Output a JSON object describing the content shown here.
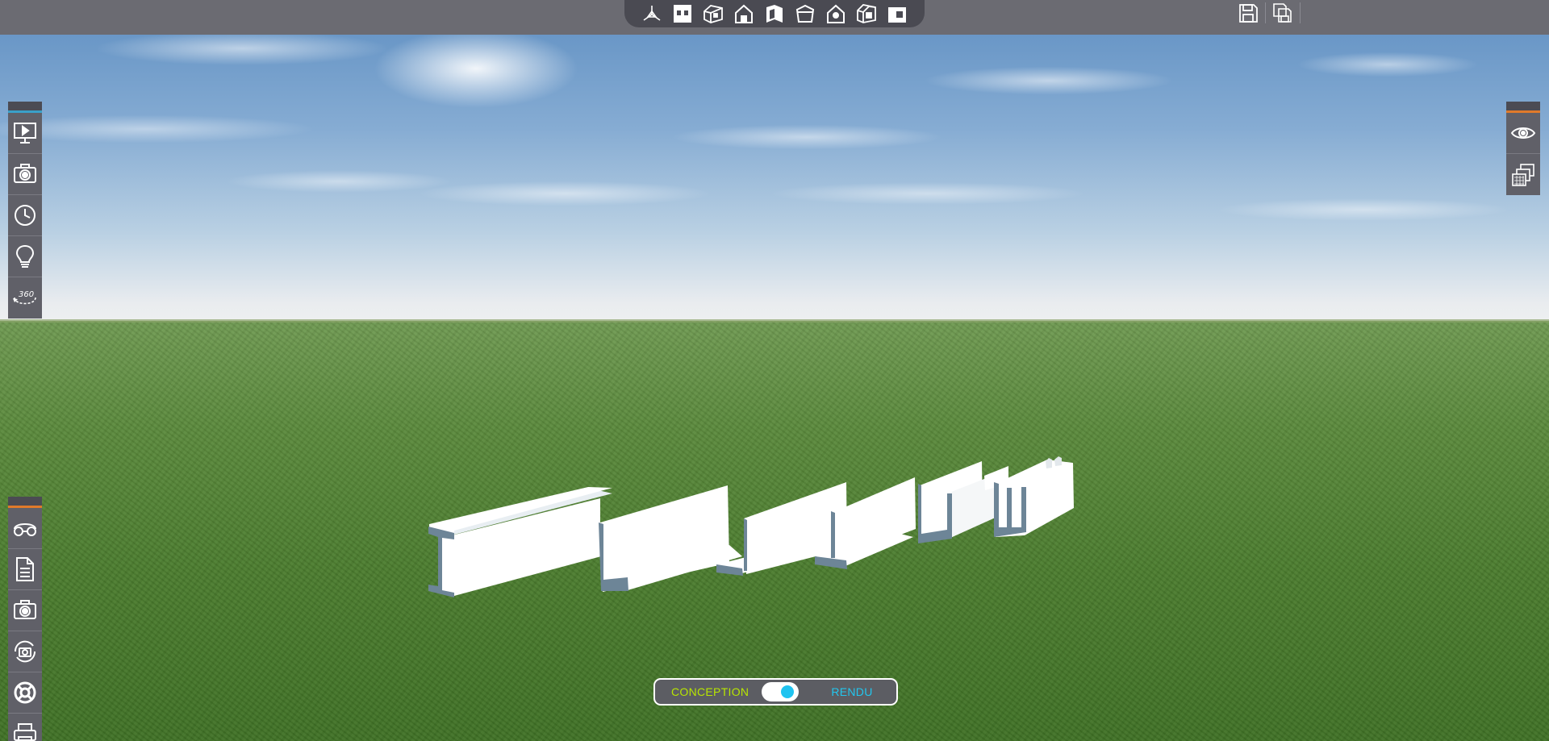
{
  "toolbar": {
    "view_buttons": [
      {
        "icon": "axes-3d-icon"
      },
      {
        "icon": "top-view-icon"
      },
      {
        "icon": "perspective-house-icon"
      },
      {
        "icon": "front-view-icon"
      },
      {
        "icon": "left-view-icon"
      },
      {
        "icon": "back-view-icon"
      },
      {
        "icon": "right-view-icon"
      },
      {
        "icon": "isometric-house-icon"
      },
      {
        "icon": "bottom-view-icon"
      }
    ],
    "right_buttons": [
      {
        "icon": "save-icon"
      },
      {
        "icon": "save-as-icon"
      }
    ]
  },
  "left_top_panel": [
    "presentation-screen-icon",
    "camera-icon",
    "clock-icon",
    "lightbulb-icon",
    "rotate-360-icon"
  ],
  "right_top_panel": [
    "eye-icon",
    "layers-icon"
  ],
  "left_bottom_panel": [
    "glasses-icon",
    "document-icon",
    "camera-icon",
    "camera-rotate-icon",
    "lifebuoy-icon",
    "printer-icon"
  ],
  "mode_toggle": {
    "left_label": "CONCEPTION",
    "right_label": "RENDU",
    "state": "RENDU",
    "accent_left": "#b8e600",
    "accent_right": "#22c6ee"
  },
  "scene": {
    "beam_color": "#ffffff",
    "beam_shade": "#6d8597",
    "sky_color": "#86acd3",
    "ground_color": "#4b7c2e"
  }
}
